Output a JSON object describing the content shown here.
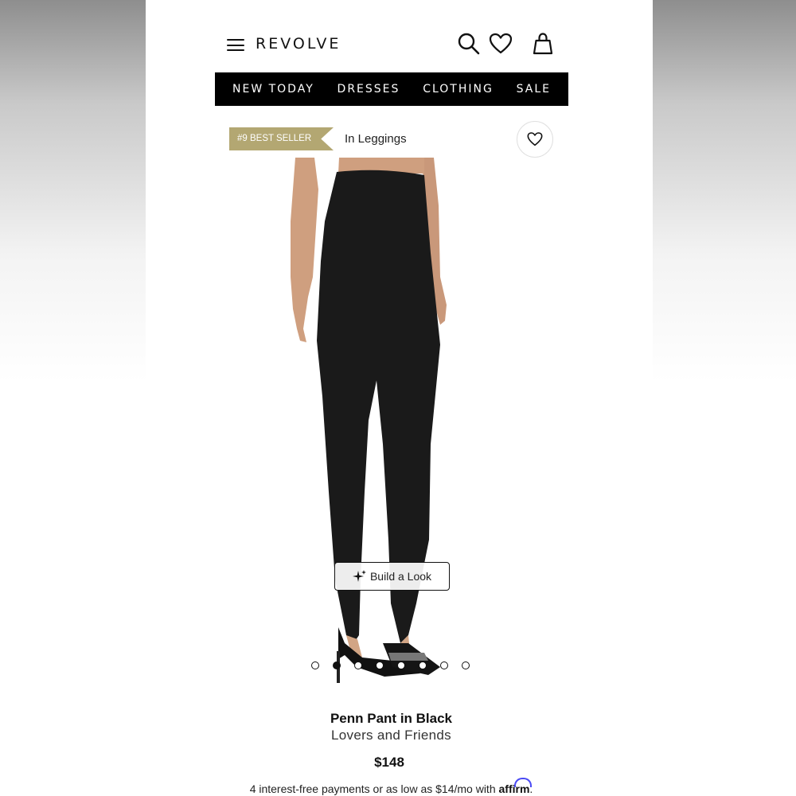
{
  "header": {
    "brand": "REVOLVE",
    "icons": [
      "menu-icon",
      "search-icon",
      "heart-icon",
      "shopping-bag-icon"
    ]
  },
  "nav": {
    "items": [
      {
        "label": "NEW TODAY"
      },
      {
        "label": "DRESSES"
      },
      {
        "label": "CLOTHING"
      },
      {
        "label": "SALE"
      }
    ]
  },
  "badge": {
    "label": "#9 BEST SELLER",
    "category": "In Leggings",
    "color": "#b3a772"
  },
  "gallery": {
    "build_look_label": "Build a Look",
    "image_count": 8,
    "active_index": 1
  },
  "product": {
    "name": "Penn Pant in Black",
    "designer": "Lovers and Friends",
    "price": "$148",
    "financing": "4 interest-free payments or as low as $14/mo with",
    "financing_brand": "affirm"
  }
}
